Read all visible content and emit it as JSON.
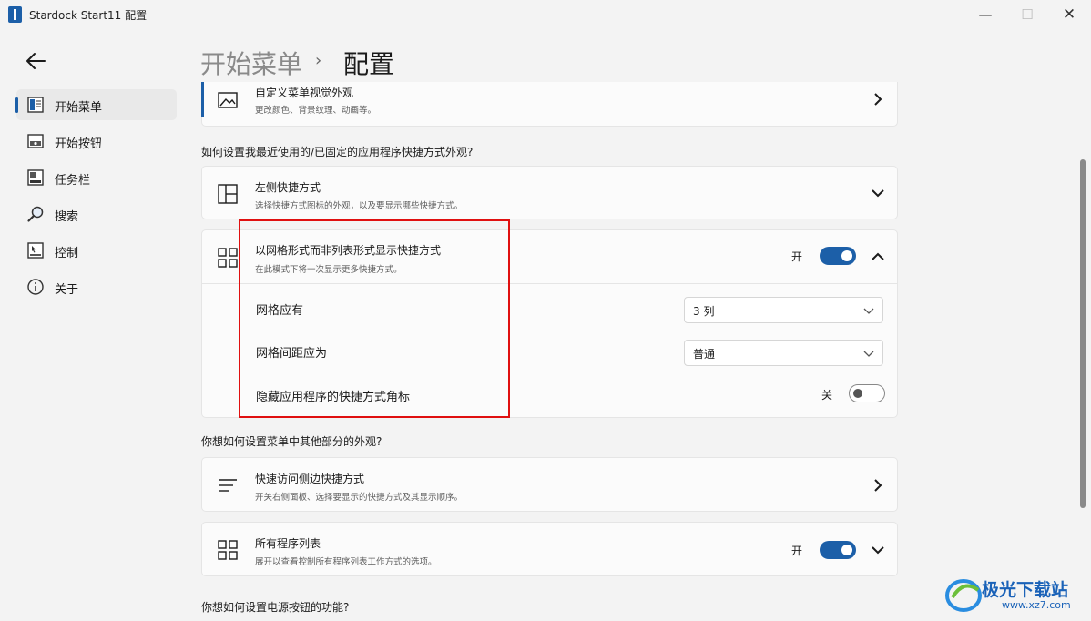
{
  "window": {
    "title": "Stardock Start11 配置",
    "minimize_glyph": "—",
    "maximize_glyph": "☐",
    "close_glyph": "✕"
  },
  "sidebar": {
    "back_icon": "arrow-left-icon",
    "items": [
      {
        "label": "开始菜单",
        "icon": "start-menu-icon",
        "active": true
      },
      {
        "label": "开始按钮",
        "icon": "start-button-icon",
        "active": false
      },
      {
        "label": "任务栏",
        "icon": "taskbar-icon",
        "active": false
      },
      {
        "label": "搜索",
        "icon": "search-icon",
        "active": false
      },
      {
        "label": "控制",
        "icon": "control-icon",
        "active": false
      },
      {
        "label": "关于",
        "icon": "info-icon",
        "active": false
      }
    ]
  },
  "header": {
    "parent": "开始菜单",
    "separator": "›",
    "current": "配置"
  },
  "cards": {
    "visual": {
      "title": "自定义菜单视觉外观",
      "subtitle": "更改颜色、背景纹理、动画等。"
    },
    "q1": "如何设置我最近使用的/已固定的应用程序快捷方式外观?",
    "left_shortcuts": {
      "title": "左侧快捷方式",
      "subtitle": "选择快捷方式图标的外观，以及要显示哪些快捷方式。"
    },
    "grid": {
      "title": "以网格形式而非列表形式显示快捷方式",
      "subtitle": "在此模式下将一次显示更多快捷方式。",
      "toggle_state": "开",
      "toggle_on": true,
      "rows": {
        "columns_label": "网格应有",
        "columns_value": "3 列",
        "spacing_label": "网格间距应为",
        "spacing_value": "普通",
        "hide_badges_label": "隐藏应用程序的快捷方式角标",
        "hide_badges_state": "关",
        "hide_badges_on": false
      }
    },
    "q2": "你想如何设置菜单中其他部分的外观?",
    "quick_access": {
      "title": "快速访问侧边快捷方式",
      "subtitle": "开关右侧面板、选择要显示的快捷方式及其显示顺序。"
    },
    "all_programs": {
      "title": "所有程序列表",
      "subtitle": "展开以查看控制所有程序列表工作方式的选项。",
      "toggle_state": "开",
      "toggle_on": true
    },
    "q3": "你想如何设置电源按钮的功能?"
  },
  "watermark": {
    "text": "极光下载站",
    "url": "www.xz7.com"
  },
  "colors": {
    "accent": "#1c5fa8",
    "highlight": "#e01010"
  }
}
